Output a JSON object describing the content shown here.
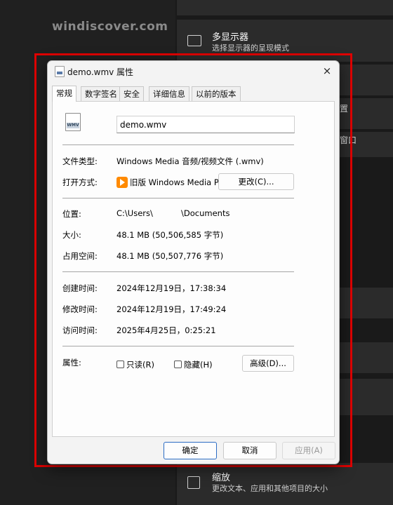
{
  "watermark": "windiscover.com",
  "settings": {
    "display_title": "多显示器",
    "display_sub": "选择显示器的呈现模式",
    "scale_title": "缩放",
    "scale_sub": "更改文本、应用和其他项目的大小",
    "peek_1": "置",
    "peek_2": "窗口"
  },
  "dialog": {
    "title": "demo.wmv 属性",
    "close_icon": "×",
    "tabs": [
      "常规",
      "数字签名",
      "安全",
      "详细信息",
      "以前的版本"
    ],
    "file_icon_text": "WMV",
    "file_name": "demo.wmv",
    "file_type_label": "文件类型:",
    "file_type_value": "Windows Media 音频/视频文件 (.wmv)",
    "open_with_label": "打开方式:",
    "open_with_value": "旧版 Windows Media Player",
    "change_button": "更改(C)...",
    "location_label": "位置:",
    "location_value_a": "C:\\Users\\",
    "location_value_b": "\\Documents",
    "size_label": "大小:",
    "size_value": "48.1 MB (50,506,585 字节)",
    "size_on_disk_label": "占用空间:",
    "size_on_disk_value": "48.1 MB (50,507,776 字节)",
    "created_label": "创建时间:",
    "created_value": "2024年12月19日，17:38:34",
    "modified_label": "修改时间:",
    "modified_value": "2024年12月19日，17:49:24",
    "accessed_label": "访问时间:",
    "accessed_value": "2025年4月25日，0:25:21",
    "attributes_label": "属性:",
    "readonly_label": "只读(R)",
    "hidden_label": "隐藏(H)",
    "advanced_button": "高级(D)...",
    "ok_button": "确定",
    "cancel_button": "取消",
    "apply_button": "应用(A)"
  },
  "colors": {
    "highlight_frame": "#e00000",
    "primary_button_border": "#2b6cc4",
    "player_icon": "#ff8a00"
  }
}
